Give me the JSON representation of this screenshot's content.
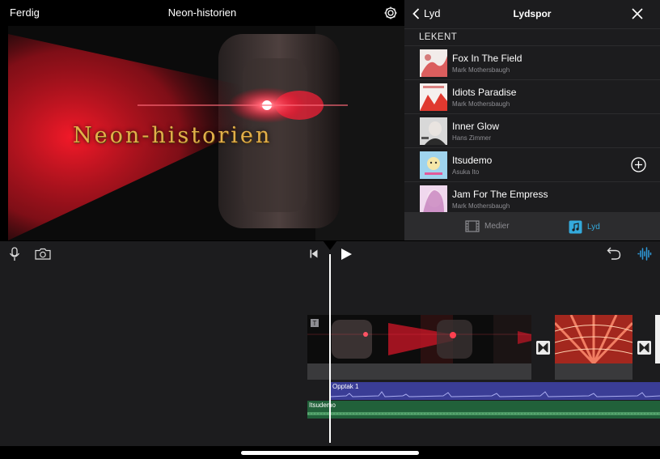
{
  "topbar": {
    "done_label": "Ferdig",
    "project_title": "Neon-historien",
    "settings_icon": "gear-icon"
  },
  "viewer": {
    "title_text": "Neon-historien"
  },
  "panel": {
    "back_label": "Lyd",
    "title": "Lydspor",
    "close_icon": "close-icon",
    "section_header": "LEKENT",
    "tracks": [
      {
        "title": "Fox In The Field",
        "artist": "Mark Mothersbaugh"
      },
      {
        "title": "Idiots Paradise",
        "artist": "Mark Mothersbaugh"
      },
      {
        "title": "Inner Glow",
        "artist": "Hans Zimmer"
      },
      {
        "title": "Itsudemo",
        "artist": "Asuka Ito"
      },
      {
        "title": "Jam For The Empress",
        "artist": "Mark Mothersbaugh"
      }
    ],
    "tabs": [
      {
        "label": "Medier",
        "icon": "film-icon",
        "selected": false
      },
      {
        "label": "Lyd",
        "icon": "music-note-icon",
        "selected": true
      }
    ]
  },
  "timeline": {
    "toolbar_icons": [
      "microphone-icon",
      "camera-icon",
      "skip-to-start-icon",
      "play-icon",
      "undo-icon",
      "audio-waveform-icon"
    ],
    "recording_label": "Opptak 1",
    "music_label": "Itsudemo"
  },
  "colors": {
    "accent": "#34aadc",
    "recording_track": "#3a3d96",
    "music_track": "#21613a",
    "title_gold": "#e3b04a"
  }
}
